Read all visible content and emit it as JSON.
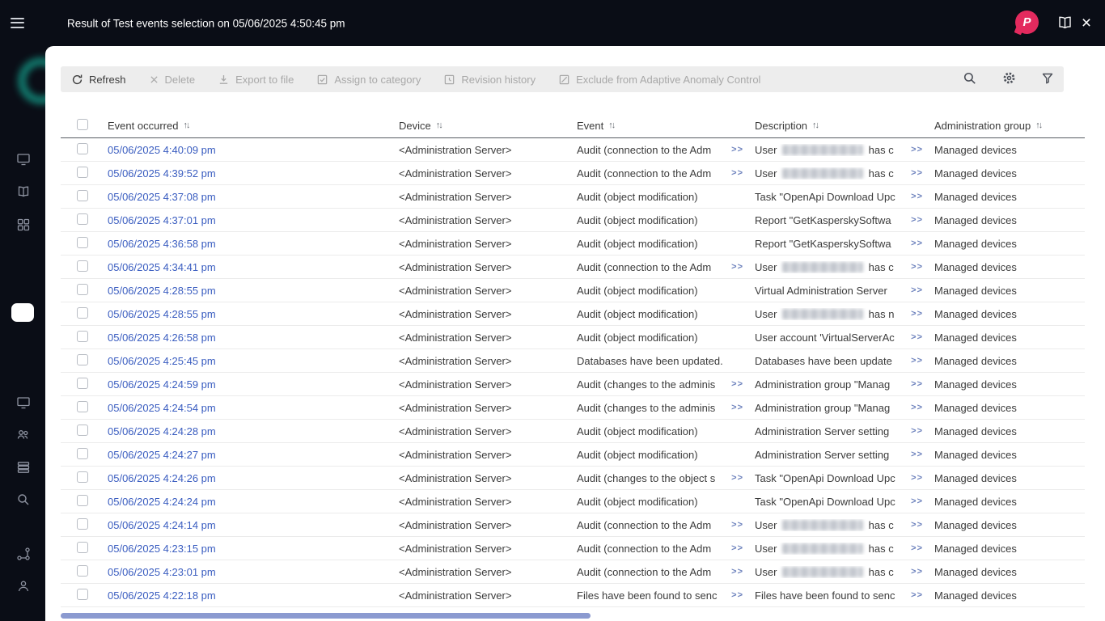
{
  "topbar": {
    "title": "Result of Test events selection on 05/06/2025 4:50:45 pm",
    "badge_letter": "P",
    "close_glyph": "×"
  },
  "sidebar": {
    "icons": [
      "monitor",
      "book",
      "grid",
      "monitor",
      "users",
      "server-stack",
      "search",
      "nodes",
      "user"
    ]
  },
  "toolbar": {
    "buttons": [
      {
        "label": "Refresh",
        "enabled": true
      },
      {
        "label": "Delete",
        "enabled": false
      },
      {
        "label": "Export to file",
        "enabled": false
      },
      {
        "label": "Assign to category",
        "enabled": false
      },
      {
        "label": "Revision history",
        "enabled": false
      },
      {
        "label": "Exclude from Adaptive Anomaly Control",
        "enabled": false
      }
    ],
    "right_icons": [
      "search",
      "settings",
      "filter"
    ]
  },
  "table": {
    "sort_glyph": "↑↓",
    "expand_glyph": ">>",
    "columns": [
      "Event occurred",
      "Device",
      "Event",
      "Description",
      "Administration group"
    ],
    "rows": [
      {
        "time": "05/06/2025 4:40:09 pm",
        "device": "<Administration Server>",
        "event": "Audit (connection to the Adm",
        "event_more": true,
        "redacted": true,
        "desc_prefix": "User",
        "desc_suffix": "has c",
        "desc_more": true,
        "group": "Managed devices"
      },
      {
        "time": "05/06/2025 4:39:52 pm",
        "device": "<Administration Server>",
        "event": "Audit (connection to the Adm",
        "event_more": true,
        "redacted": true,
        "desc_prefix": "User",
        "desc_suffix": "has c",
        "desc_more": true,
        "group": "Managed devices"
      },
      {
        "time": "05/06/2025 4:37:08 pm",
        "device": "<Administration Server>",
        "event": "Audit (object modification)",
        "event_more": false,
        "redacted": false,
        "desc": "Task \"OpenApi Download Upc",
        "desc_more": true,
        "group": "Managed devices"
      },
      {
        "time": "05/06/2025 4:37:01 pm",
        "device": "<Administration Server>",
        "event": "Audit (object modification)",
        "event_more": false,
        "redacted": false,
        "desc": "Report \"GetKasperskySoftwa",
        "desc_more": true,
        "group": "Managed devices"
      },
      {
        "time": "05/06/2025 4:36:58 pm",
        "device": "<Administration Server>",
        "event": "Audit (object modification)",
        "event_more": false,
        "redacted": false,
        "desc": "Report \"GetKasperskySoftwa",
        "desc_more": true,
        "group": "Managed devices"
      },
      {
        "time": "05/06/2025 4:34:41 pm",
        "device": "<Administration Server>",
        "event": "Audit (connection to the Adm",
        "event_more": true,
        "redacted": true,
        "desc_prefix": "User",
        "desc_suffix": "has c",
        "desc_more": true,
        "group": "Managed devices"
      },
      {
        "time": "05/06/2025 4:28:55 pm",
        "device": "<Administration Server>",
        "event": "Audit (object modification)",
        "event_more": false,
        "redacted": false,
        "desc": "Virtual Administration Server",
        "desc_more": true,
        "group": "Managed devices"
      },
      {
        "time": "05/06/2025 4:28:55 pm",
        "device": "<Administration Server>",
        "event": "Audit (object modification)",
        "event_more": false,
        "redacted": true,
        "desc_prefix": "User",
        "desc_suffix": "has n",
        "desc_more": true,
        "group": "Managed devices"
      },
      {
        "time": "05/06/2025 4:26:58 pm",
        "device": "<Administration Server>",
        "event": "Audit (object modification)",
        "event_more": false,
        "redacted": false,
        "desc": "User account 'VirtualServerAc",
        "desc_more": true,
        "group": "Managed devices"
      },
      {
        "time": "05/06/2025 4:25:45 pm",
        "device": "<Administration Server>",
        "event": "Databases have been updated.",
        "event_more": false,
        "redacted": false,
        "desc": "Databases have been update",
        "desc_more": true,
        "group": "Managed devices"
      },
      {
        "time": "05/06/2025 4:24:59 pm",
        "device": "<Administration Server>",
        "event": "Audit (changes to the adminis",
        "event_more": true,
        "redacted": false,
        "desc": "Administration group \"Manag",
        "desc_more": true,
        "group": "Managed devices"
      },
      {
        "time": "05/06/2025 4:24:54 pm",
        "device": "<Administration Server>",
        "event": "Audit (changes to the adminis",
        "event_more": true,
        "redacted": false,
        "desc": "Administration group \"Manag",
        "desc_more": true,
        "group": "Managed devices"
      },
      {
        "time": "05/06/2025 4:24:28 pm",
        "device": "<Administration Server>",
        "event": "Audit (object modification)",
        "event_more": false,
        "redacted": false,
        "desc": "Administration Server setting",
        "desc_more": true,
        "group": "Managed devices"
      },
      {
        "time": "05/06/2025 4:24:27 pm",
        "device": "<Administration Server>",
        "event": "Audit (object modification)",
        "event_more": false,
        "redacted": false,
        "desc": "Administration Server setting",
        "desc_more": true,
        "group": "Managed devices"
      },
      {
        "time": "05/06/2025 4:24:26 pm",
        "device": "<Administration Server>",
        "event": "Audit (changes to the object s",
        "event_more": true,
        "redacted": false,
        "desc": "Task \"OpenApi Download Upc",
        "desc_more": true,
        "group": "Managed devices"
      },
      {
        "time": "05/06/2025 4:24:24 pm",
        "device": "<Administration Server>",
        "event": "Audit (object modification)",
        "event_more": false,
        "redacted": false,
        "desc": "Task \"OpenApi Download Upc",
        "desc_more": true,
        "group": "Managed devices"
      },
      {
        "time": "05/06/2025 4:24:14 pm",
        "device": "<Administration Server>",
        "event": "Audit (connection to the Adm",
        "event_more": true,
        "redacted": true,
        "desc_prefix": "User",
        "desc_suffix": "has c",
        "desc_more": true,
        "group": "Managed devices"
      },
      {
        "time": "05/06/2025 4:23:15 pm",
        "device": "<Administration Server>",
        "event": "Audit (connection to the Adm",
        "event_more": true,
        "redacted": true,
        "desc_prefix": "User",
        "desc_suffix": "has c",
        "desc_more": true,
        "group": "Managed devices"
      },
      {
        "time": "05/06/2025 4:23:01 pm",
        "device": "<Administration Server>",
        "event": "Audit (connection to the Adm",
        "event_more": true,
        "redacted": true,
        "desc_prefix": "User",
        "desc_suffix": "has c",
        "desc_more": true,
        "group": "Managed devices"
      },
      {
        "time": "05/06/2025 4:22:18 pm",
        "device": "<Administration Server>",
        "event": "Files have been found to senc",
        "event_more": true,
        "redacted": false,
        "desc": "Files have been found to senc",
        "desc_more": true,
        "group": "Managed devices"
      }
    ]
  }
}
